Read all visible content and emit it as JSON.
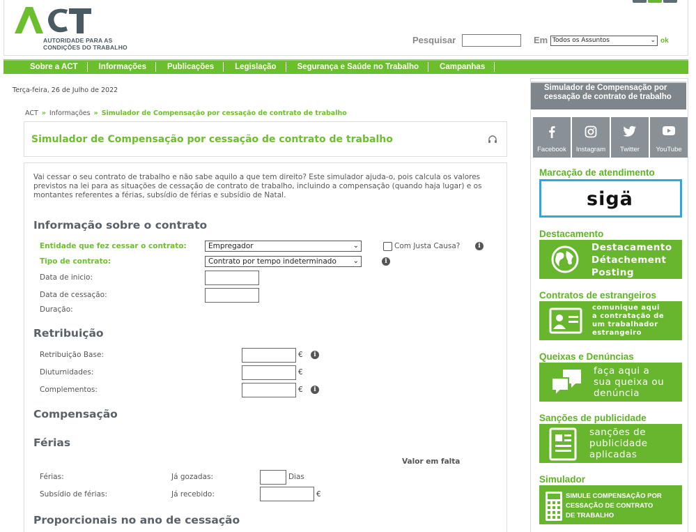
{
  "header": {
    "logo_text": "ACT",
    "logo_subtitle_line1": "AUTORIDADE PARA AS",
    "logo_subtitle_line2": "CONDIÇÕES DO TRABALHO",
    "search_label": "Pesquisar",
    "search_value": "",
    "in_label": "Em",
    "in_select": "Todos os Assuntos",
    "ok_label": "ok"
  },
  "nav": {
    "items": [
      "Sobre a ACT",
      "Informações",
      "Publicações",
      "Legislação",
      "Segurança e Saúde no Trabalho",
      "Campanhas"
    ]
  },
  "date": "Terça-feira, 26 de Julho de 2022",
  "breadcrumb": {
    "items": [
      "ACT",
      "Informações"
    ],
    "current": "Simulador de Compensação por cessação de contrato de trabalho",
    "separator": "»"
  },
  "page_title": "Simulador de Compensação por cessação de contrato de trabalho",
  "intro": "Vai cessar o seu contrato de trabalho e não sabe aquilo a que tem direito? Este simulador ajuda-o, pois calcula os valores previstos na lei para as situações de cessação de contrato de trabalho, incluindo a compensação (quando haja lugar) e os montantes referentes a férias, subsídio de férias e subsídio de Natal.",
  "contract": {
    "heading": "Informação sobre o contrato",
    "entity_label": "Entidade que fez cessar o contrato:",
    "entity_value": "Empregador",
    "just_cause_label": "Com Justa Causa?",
    "type_label": "Tipo de contrato:",
    "type_value": "Contrato por tempo indeterminado",
    "start_label": "Data de inicio:",
    "end_label": "Data de cessação:",
    "duration_label": "Duração:"
  },
  "pay": {
    "heading": "Retribuição",
    "base_label": "Retribuição Base:",
    "seniority_label": "Diuturnidades:",
    "extras_label": "Complementos:",
    "currency": "€"
  },
  "compensation": {
    "heading": "Compensação"
  },
  "holidays": {
    "heading": "Férias",
    "missing_label": "Valor em falta",
    "holidays_label": "Férias:",
    "taken_label": "Já gozadas:",
    "days_unit": "Dias",
    "allowance_label": "Subsídio de férias:",
    "received_label": "Já recebido:",
    "currency": "€"
  },
  "proportional": {
    "heading": "Proporcionais no ano de cessação"
  },
  "sidebar": {
    "header": "Simulador de Compensação por cessação de contrato de trabalho",
    "social": [
      {
        "name": "Facebook",
        "icon": "facebook-icon"
      },
      {
        "name": "Instagram",
        "icon": "instagram-icon"
      },
      {
        "name": "Twitter",
        "icon": "twitter-icon"
      },
      {
        "name": "YouTube",
        "icon": "youtube-icon"
      }
    ],
    "appointment_title": "Marcação de atendimento",
    "siga_text": "sigä",
    "posting_title": "Destacamento",
    "posting_lines": [
      "Destacamento",
      "Détachement",
      "Posting"
    ],
    "foreign_title": "Contratos de estrangeiros",
    "foreign_lines": [
      "comunique aqui",
      "a contratação de",
      "um trabalhador",
      "estrangeiro"
    ],
    "complaints_title": "Queixas e Denúncias",
    "complaints_lines": [
      "faça aqui a",
      "sua queixa ou",
      "denúncia"
    ],
    "sanctions_title": "Sanções de publicidade",
    "sanctions_lines": [
      "sanções de",
      "publicidade",
      "aplicadas"
    ],
    "simulator_title": "Simulador",
    "simulator_lines": [
      "SIMULE COMPENSAÇÃO POR",
      "CESSAÇÃO DE CONTRATO",
      "DE TRABALHO"
    ]
  },
  "colors": {
    "brand_green": "#6cbf2c",
    "brand_grey": "#5d6b73",
    "siga_blue": "#29a9e0"
  }
}
